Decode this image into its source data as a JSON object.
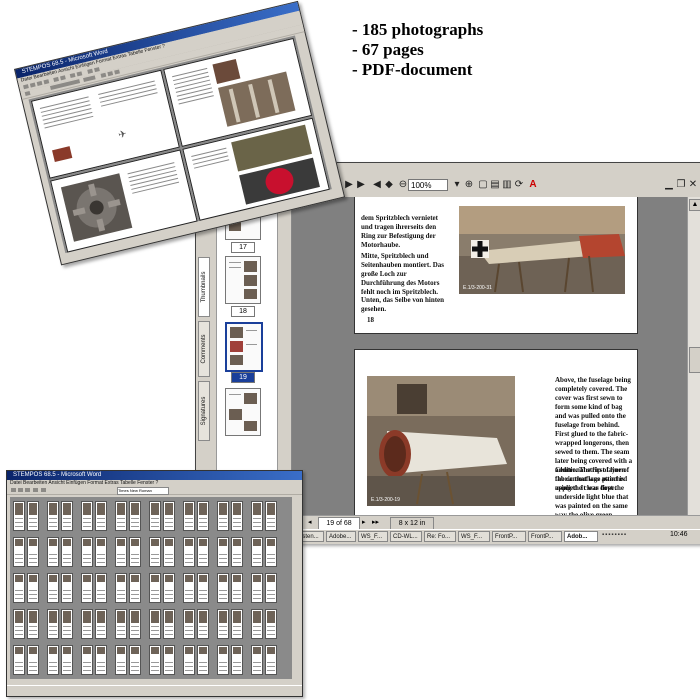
{
  "caption": {
    "lines": [
      "- 185 photographs",
      "- 67 pages",
      "- PDF-document"
    ]
  },
  "tilted_window": {
    "title": "STEMPOS 68.5 - Microsoft Word",
    "menu": "Datei  Bearbeiten  Ansicht  Einfügen  Format  Extras  Tabelle  Fenster  ?"
  },
  "small_window": {
    "title": "STEMPOS 68.5 - Microsoft Word",
    "menu": "Datei  Bearbeiten  Ansicht  Einfügen  Format  Extras  Tabelle  Fenster  ?",
    "font": "Times New Roman"
  },
  "acrobat": {
    "zoom": "100%",
    "side_tabs": [
      "Thumbnails",
      "Comments",
      "Signatures"
    ],
    "thumb_numbers": [
      "17",
      "18",
      "19"
    ],
    "page_status": "19 of 68",
    "page_size": "8 x 12 in",
    "page_top": {
      "text_de_1": "dem Spritzblech vernietet und tragen ihrerseits den Ring zur Befestigung der Motorhaube.",
      "text_de_2": "Mitte, Spritzblech und Seitenhauben montiert. Das große Loch zur Durchführung des Motors fehlt noch im Spritzblech.",
      "text_de_3": "Unten, das Selbe von hinten gesehen.",
      "page_number": "18",
      "photo_caption": "E.1/3-200-31"
    },
    "page_main": {
      "text_1": "Above, the fuselage being completely covered. The cover was first sewn to form some kind of bag and was pulled onto the fuselage from behind. First glued to the fabric-wrapped longerons, then sewed to them. The seam later being covered with a additional strip of linen fabric that was attached using the clear dope.",
      "text_2": "Centre. The first layer of the camouflage paint is applied. It was first the underside light blue that was painted on the same way the olive green followed later.",
      "photo_caption": "E.1/3-200-19"
    }
  },
  "taskbar": {
    "items": [
      "Sesten...",
      "Adobe...",
      "WS_F...",
      "CD-WL...",
      "Re: Fo...",
      "WS_F...",
      "FrontP...",
      "FrontP...",
      "Adob..."
    ],
    "clock": "10:46"
  },
  "colors": {
    "title_blue": "#0a246a",
    "chrome_gray": "#d4d0c8",
    "doc_background": "#808080",
    "selected_thumb": "#1a3f9a"
  }
}
